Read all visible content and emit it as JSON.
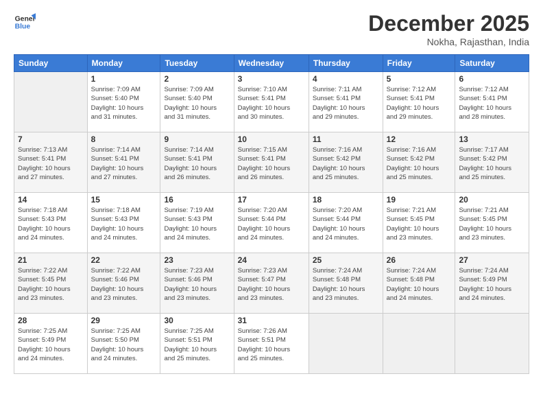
{
  "header": {
    "logo_line1": "General",
    "logo_line2": "Blue",
    "month": "December 2025",
    "location": "Nokha, Rajasthan, India"
  },
  "days_of_week": [
    "Sunday",
    "Monday",
    "Tuesday",
    "Wednesday",
    "Thursday",
    "Friday",
    "Saturday"
  ],
  "weeks": [
    [
      {
        "day": "",
        "info": ""
      },
      {
        "day": "1",
        "info": "Sunrise: 7:09 AM\nSunset: 5:40 PM\nDaylight: 10 hours\nand 31 minutes."
      },
      {
        "day": "2",
        "info": "Sunrise: 7:09 AM\nSunset: 5:40 PM\nDaylight: 10 hours\nand 31 minutes."
      },
      {
        "day": "3",
        "info": "Sunrise: 7:10 AM\nSunset: 5:41 PM\nDaylight: 10 hours\nand 30 minutes."
      },
      {
        "day": "4",
        "info": "Sunrise: 7:11 AM\nSunset: 5:41 PM\nDaylight: 10 hours\nand 29 minutes."
      },
      {
        "day": "5",
        "info": "Sunrise: 7:12 AM\nSunset: 5:41 PM\nDaylight: 10 hours\nand 29 minutes."
      },
      {
        "day": "6",
        "info": "Sunrise: 7:12 AM\nSunset: 5:41 PM\nDaylight: 10 hours\nand 28 minutes."
      }
    ],
    [
      {
        "day": "7",
        "info": "Sunrise: 7:13 AM\nSunset: 5:41 PM\nDaylight: 10 hours\nand 27 minutes."
      },
      {
        "day": "8",
        "info": "Sunrise: 7:14 AM\nSunset: 5:41 PM\nDaylight: 10 hours\nand 27 minutes."
      },
      {
        "day": "9",
        "info": "Sunrise: 7:14 AM\nSunset: 5:41 PM\nDaylight: 10 hours\nand 26 minutes."
      },
      {
        "day": "10",
        "info": "Sunrise: 7:15 AM\nSunset: 5:41 PM\nDaylight: 10 hours\nand 26 minutes."
      },
      {
        "day": "11",
        "info": "Sunrise: 7:16 AM\nSunset: 5:42 PM\nDaylight: 10 hours\nand 25 minutes."
      },
      {
        "day": "12",
        "info": "Sunrise: 7:16 AM\nSunset: 5:42 PM\nDaylight: 10 hours\nand 25 minutes."
      },
      {
        "day": "13",
        "info": "Sunrise: 7:17 AM\nSunset: 5:42 PM\nDaylight: 10 hours\nand 25 minutes."
      }
    ],
    [
      {
        "day": "14",
        "info": "Sunrise: 7:18 AM\nSunset: 5:43 PM\nDaylight: 10 hours\nand 24 minutes."
      },
      {
        "day": "15",
        "info": "Sunrise: 7:18 AM\nSunset: 5:43 PM\nDaylight: 10 hours\nand 24 minutes."
      },
      {
        "day": "16",
        "info": "Sunrise: 7:19 AM\nSunset: 5:43 PM\nDaylight: 10 hours\nand 24 minutes."
      },
      {
        "day": "17",
        "info": "Sunrise: 7:20 AM\nSunset: 5:44 PM\nDaylight: 10 hours\nand 24 minutes."
      },
      {
        "day": "18",
        "info": "Sunrise: 7:20 AM\nSunset: 5:44 PM\nDaylight: 10 hours\nand 24 minutes."
      },
      {
        "day": "19",
        "info": "Sunrise: 7:21 AM\nSunset: 5:45 PM\nDaylight: 10 hours\nand 23 minutes."
      },
      {
        "day": "20",
        "info": "Sunrise: 7:21 AM\nSunset: 5:45 PM\nDaylight: 10 hours\nand 23 minutes."
      }
    ],
    [
      {
        "day": "21",
        "info": "Sunrise: 7:22 AM\nSunset: 5:45 PM\nDaylight: 10 hours\nand 23 minutes."
      },
      {
        "day": "22",
        "info": "Sunrise: 7:22 AM\nSunset: 5:46 PM\nDaylight: 10 hours\nand 23 minutes."
      },
      {
        "day": "23",
        "info": "Sunrise: 7:23 AM\nSunset: 5:46 PM\nDaylight: 10 hours\nand 23 minutes."
      },
      {
        "day": "24",
        "info": "Sunrise: 7:23 AM\nSunset: 5:47 PM\nDaylight: 10 hours\nand 23 minutes."
      },
      {
        "day": "25",
        "info": "Sunrise: 7:24 AM\nSunset: 5:48 PM\nDaylight: 10 hours\nand 23 minutes."
      },
      {
        "day": "26",
        "info": "Sunrise: 7:24 AM\nSunset: 5:48 PM\nDaylight: 10 hours\nand 24 minutes."
      },
      {
        "day": "27",
        "info": "Sunrise: 7:24 AM\nSunset: 5:49 PM\nDaylight: 10 hours\nand 24 minutes."
      }
    ],
    [
      {
        "day": "28",
        "info": "Sunrise: 7:25 AM\nSunset: 5:49 PM\nDaylight: 10 hours\nand 24 minutes."
      },
      {
        "day": "29",
        "info": "Sunrise: 7:25 AM\nSunset: 5:50 PM\nDaylight: 10 hours\nand 24 minutes."
      },
      {
        "day": "30",
        "info": "Sunrise: 7:25 AM\nSunset: 5:51 PM\nDaylight: 10 hours\nand 25 minutes."
      },
      {
        "day": "31",
        "info": "Sunrise: 7:26 AM\nSunset: 5:51 PM\nDaylight: 10 hours\nand 25 minutes."
      },
      {
        "day": "",
        "info": ""
      },
      {
        "day": "",
        "info": ""
      },
      {
        "day": "",
        "info": ""
      }
    ]
  ]
}
